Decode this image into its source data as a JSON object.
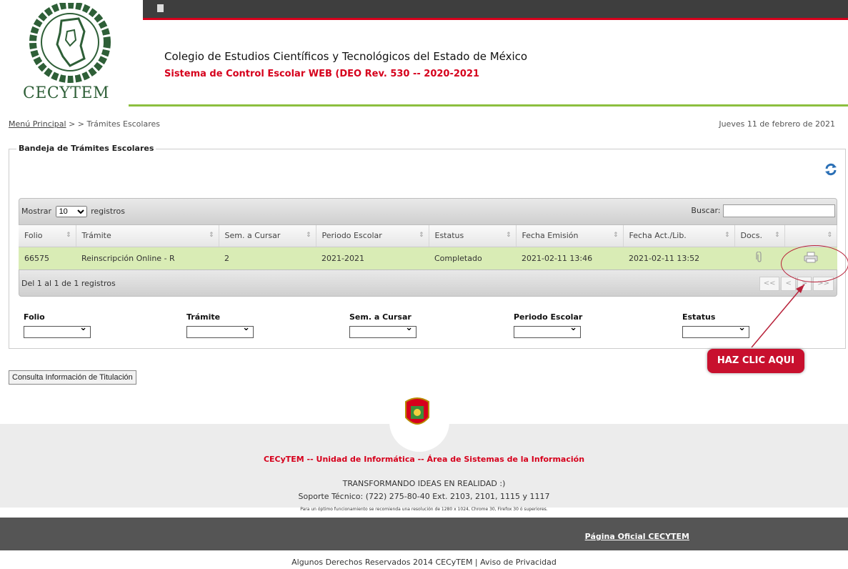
{
  "header": {
    "institution": "Colegio de Estudios Científicos y Tecnológicos del Estado de México",
    "system": "Sistema de Control Escolar WEB (DEO Rev. 530   -- 2020-2021",
    "logo_text": "CECYTEM"
  },
  "breadcrumb": {
    "home_link": "Menú Principal",
    "rest": " > > Trámites Escolares"
  },
  "date": "Jueves 11 de febrero de 2021",
  "panel": {
    "legend": "Bandeja de Trámites Escolares"
  },
  "table": {
    "show_prefix": "Mostrar",
    "show_value": "10",
    "show_suffix": "registros",
    "search_label": "Buscar:",
    "search_value": "",
    "columns": [
      "Folio",
      "Trámite",
      "Sem. a Cursar",
      "Periodo Escolar",
      "Estatus",
      "Fecha Emisión",
      "Fecha Act./Lib.",
      "Docs.",
      ""
    ],
    "rows": [
      {
        "folio": "66575",
        "tramite": "Reinscripción Online - R",
        "semestre": "2",
        "periodo": "2021-2021",
        "estatus": "Completado",
        "emision": "2021-02-11 13:46",
        "actualizacion": "2021-02-11 13:52"
      }
    ],
    "info": "Del 1 al 1 de 1 registros",
    "pager": [
      "<<",
      "<",
      ">",
      ">>"
    ]
  },
  "filters": [
    "Folio",
    "Trámite",
    "Sem. a Cursar",
    "Periodo Escolar",
    "Estatus"
  ],
  "callout": {
    "label": "HAZ CLIC AQUI",
    "color": "#c8102e"
  },
  "buttons": {
    "consulta": "Consulta Información de Titulación"
  },
  "footer": {
    "unit": "CECyTEM -- Unidad de Informática -- Área de Sistemas de la Información",
    "slogan": "TRANSFORMANDO IDEAS EN REALIDAD :)",
    "support": "Soporte Técnico: (722) 275-80-40 Ext. 2103, 2101, 1115 y 1117",
    "note": "Para un óptimo funcionamiento se recomienda una resolución de 1280 x 1024, Chrome 30, Firefox 30 ó superiores.",
    "official_link": "Página Oficial CECYTEM",
    "rights": "Algunos Derechos Reservados 2014 CECyTEM | Aviso de Privacidad"
  },
  "colors": {
    "accent_red": "#d6001c",
    "accent_green": "#8cbf3f",
    "row_highlight": "#d9ecb5"
  }
}
